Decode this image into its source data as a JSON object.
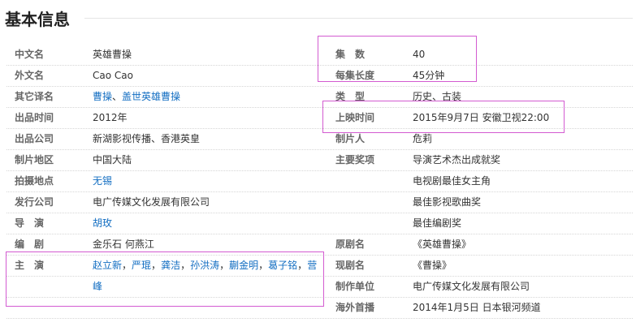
{
  "title": "基本信息",
  "rows": [
    {
      "left_key": "中文名",
      "left_value": "英雄曹操",
      "right_key": "集　数",
      "right_value": "40"
    },
    {
      "left_key": "外文名",
      "left_value": "Cao Cao",
      "right_key": "每集长度",
      "right_value": "45分钟"
    },
    {
      "left_key": "其它译名",
      "left_links": [
        "曹操",
        "盖世英雄曹操"
      ],
      "right_key": "类　型",
      "right_value": "历史、古装"
    },
    {
      "left_key": "出品时间",
      "left_value": "2012年",
      "right_key": "上映时间",
      "right_value": "2015年9月7日 安徽卫视22:00"
    },
    {
      "left_key": "出品公司",
      "left_value": "新湖影视传播、香港英皇",
      "right_key": "制片人",
      "right_value": "危莉"
    },
    {
      "left_key": "制片地区",
      "left_value": "中国大陆",
      "right_key": "主要奖项",
      "right_value": "导演艺术杰出成就奖"
    },
    {
      "left_key": "拍摄地点",
      "left_link": "无锡",
      "right_key": "",
      "right_value": "电视剧最佳女主角"
    },
    {
      "left_key": "发行公司",
      "left_value": "电广传媒文化发展有限公司",
      "right_key": "",
      "right_value": "最佳影视歌曲奖"
    },
    {
      "left_key": "导　演",
      "left_link": "胡玫",
      "right_key": "",
      "right_value": "最佳编剧奖"
    },
    {
      "left_key": "编　剧",
      "left_value": "金乐石 何燕江",
      "right_key": "原剧名",
      "right_value": "《英雄曹操》"
    },
    {
      "left_key": "主　演",
      "left_links": [
        "赵立新",
        "严琨",
        "龚洁",
        "孙洪涛",
        "蒯金明",
        "葛子铭",
        "营峰"
      ],
      "right_key": "现剧名",
      "right_value": "《曹操》"
    },
    {
      "left_key": "",
      "left_value": "",
      "right_key": "制作单位",
      "right_value": "电广传媒文化发展有限公司"
    },
    {
      "left_key": "",
      "left_value": "",
      "right_key": "海外首播",
      "right_value": "2014年1月5日 日本银河频道"
    }
  ],
  "highlight_color": "#d35bd1"
}
